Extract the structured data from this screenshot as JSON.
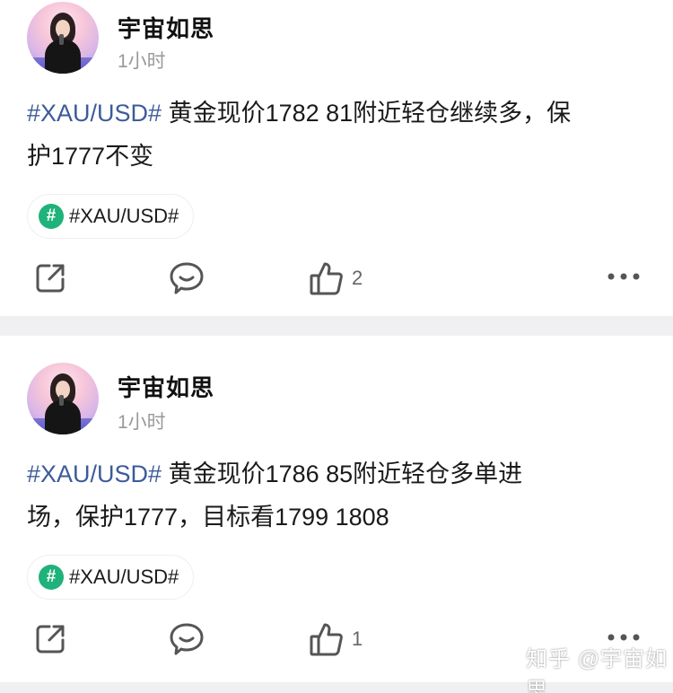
{
  "posts": [
    {
      "author": "宇宙如思",
      "time": "1小时",
      "tag": "#XAU/USD#",
      "text_line1": " 黄金现价1782 81附近轻仓继续多，保",
      "text_line2": "护1777不变",
      "topic": "#XAU/USD#",
      "topic_badge": "#",
      "likes": "2"
    },
    {
      "author": "宇宙如思",
      "time": "1小时",
      "tag": "#XAU/USD#",
      "text_line1": " 黄金现价1786 85附近轻仓多单进",
      "text_line2": "场，保护1777，目标看1799 1808",
      "topic": "#XAU/USD#",
      "topic_badge": "#",
      "likes": "1"
    }
  ],
  "icons": {
    "share": "share-icon",
    "comment": "comment-icon",
    "like": "thumbs-up-icon",
    "more": "more-icon"
  },
  "colors": {
    "tag": "#3d5b9a",
    "topic_badge": "#1fb27a",
    "separator": "#f0f0f2"
  },
  "watermark": "知乎 @宇宙如思"
}
